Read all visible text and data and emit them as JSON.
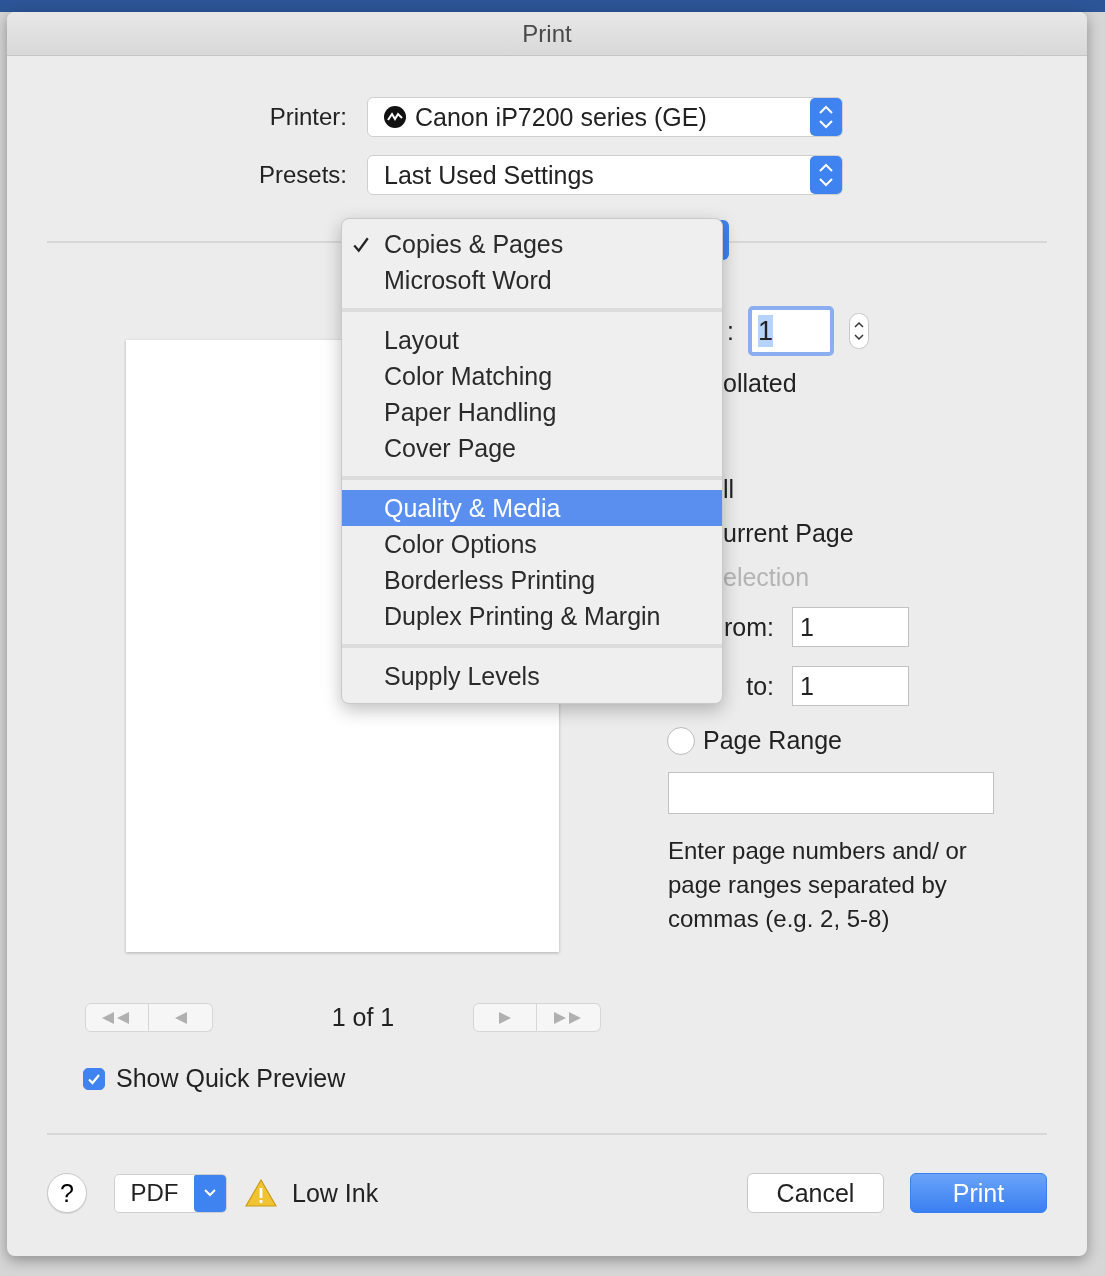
{
  "window": {
    "title": "Print"
  },
  "printer": {
    "label": "Printer:",
    "value": "Canon iP7200 series (GE)"
  },
  "presets": {
    "label": "Presets:",
    "value": "Last Used Settings"
  },
  "panel_menu": {
    "groups": [
      {
        "items": [
          {
            "label": "Copies & Pages",
            "checked": true,
            "selected": false
          },
          {
            "label": "Microsoft Word",
            "checked": false,
            "selected": false
          }
        ]
      },
      {
        "items": [
          {
            "label": "Layout",
            "checked": false,
            "selected": false
          },
          {
            "label": "Color Matching",
            "checked": false,
            "selected": false
          },
          {
            "label": "Paper Handling",
            "checked": false,
            "selected": false
          },
          {
            "label": "Cover Page",
            "checked": false,
            "selected": false
          }
        ]
      },
      {
        "items": [
          {
            "label": "Quality & Media",
            "checked": false,
            "selected": true
          },
          {
            "label": "Color Options",
            "checked": false,
            "selected": false
          },
          {
            "label": "Borderless Printing",
            "checked": false,
            "selected": false
          },
          {
            "label": "Duplex Printing & Margin",
            "checked": false,
            "selected": false
          }
        ]
      },
      {
        "items": [
          {
            "label": "Supply Levels",
            "checked": false,
            "selected": false
          }
        ]
      }
    ]
  },
  "preview": {
    "page_indicator": "1 of 1",
    "quick_preview": {
      "label": "Show Quick Preview",
      "checked": true
    }
  },
  "copies": {
    "label": ":",
    "value": "1"
  },
  "collated": {
    "label": "ollated"
  },
  "pages": {
    "options": [
      {
        "label": "ll",
        "disabled": false
      },
      {
        "label": "urrent Page",
        "disabled": false
      },
      {
        "label": "election",
        "disabled": true
      }
    ],
    "from": {
      "label": "rom:",
      "value": "1"
    },
    "to": {
      "label": "to:",
      "value": "1"
    },
    "page_range": {
      "label": "Page Range",
      "selected": false
    },
    "hint": "Enter page numbers and/ or page ranges separated by commas (e.g. 2, 5-8)"
  },
  "footer": {
    "help": "?",
    "pdf": "PDF",
    "status": {
      "kind": "warning",
      "text": "Low Ink"
    },
    "buttons": [
      {
        "label": "Cancel",
        "default": false
      },
      {
        "label": "Print",
        "default": true
      }
    ]
  }
}
